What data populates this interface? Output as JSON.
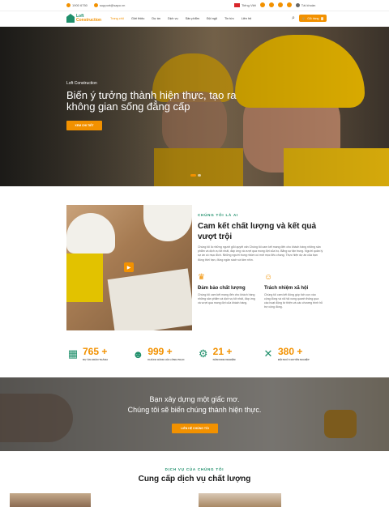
{
  "topbar": {
    "phone": "1900 6750",
    "email": "support@sapo.vn",
    "language": "Tiếng Việt",
    "account": "Tài khoản",
    "social_icons": [
      "youtube-icon",
      "facebook-icon",
      "twitter-icon",
      "instagram-icon",
      "messenger-icon"
    ]
  },
  "header": {
    "logo_line1": "Loft",
    "logo_line2": "Construction",
    "nav": [
      "Trang chủ",
      "Giới thiệu",
      "Dự án",
      "Dịch vụ",
      "Sản phẩm",
      "Đội ngũ",
      "Tin tức",
      "Liên hệ"
    ],
    "cart_label": "Giỏ hàng",
    "cart_count": "0"
  },
  "hero": {
    "subtitle": "Loft Construction",
    "title": "Biến ý tưởng thành hiện thực, tạo ra không gian sống đẳng cấp",
    "button": "XEM CHI TIẾT"
  },
  "about": {
    "eyebrow": "CHÚNG TÔI LÀ AI",
    "title": "Cam kết chất lượng và kết quả vượt trội",
    "desc": "Chúng tôi là những người giỏi quyết vấn Chúng tôi cam kết mang đến cho khách hàng những sản phẩm và dịch vụ tốt nhất, đáp ứng và vượt qua mong đợi của họ. Bằng sự tận trung. Người quản lý sự án có mục đích. Những người trung nhóm có mới mọc liêu chung. Thực hiện dự án của bạn đúng thời hạn, đúng ngân sách và tâm nhìn.",
    "features": [
      {
        "icon": "badge-icon",
        "title": "Đảm bảo chất lượng",
        "desc": "Chúng tôi cam kết mang đến cho khách hàng những sản phẩm và dịch vụ tốt nhất, đáp ứng và vượt qua mong đợi của khách hàng."
      },
      {
        "icon": "people-icon",
        "title": "Trách nhiệm xã hội",
        "desc": "Chúng tôi cam kết đóng góp tích cực vào cộng đồng và xã hội xung quanh thông qua các hoạt động từ thiện và các chương trình hỗ trợ cộng đồng."
      }
    ]
  },
  "stats": [
    {
      "icon": "building-icon",
      "num": "765 +",
      "label": "DỰ ÁN HOÀN THÀNH"
    },
    {
      "icon": "users-icon",
      "num": "999 +",
      "label": "KHÁCH HÀNG HÀI LÒNG PHỤC"
    },
    {
      "icon": "gears-icon",
      "num": "21 +",
      "label": "NĂM KINH NGHIỆM"
    },
    {
      "icon": "tools-icon",
      "num": "380 +",
      "label": "ĐỘI NGŨ CHUYÊN NGHIỆP"
    }
  ],
  "cta": {
    "line1": "Bạn xây dựng một giấc mơ.",
    "line2": "Chúng tôi sẽ biến chúng thành hiện thực.",
    "button": "LIÊN HỆ CHÚNG TÔI"
  },
  "services": {
    "eyebrow": "DỊCH VỤ CỦA CHÚNG TÔI",
    "title": "Cung cấp dịch vụ chất lượng"
  },
  "colors": {
    "accent": "#f29100",
    "brand": "#1f8f6b"
  }
}
